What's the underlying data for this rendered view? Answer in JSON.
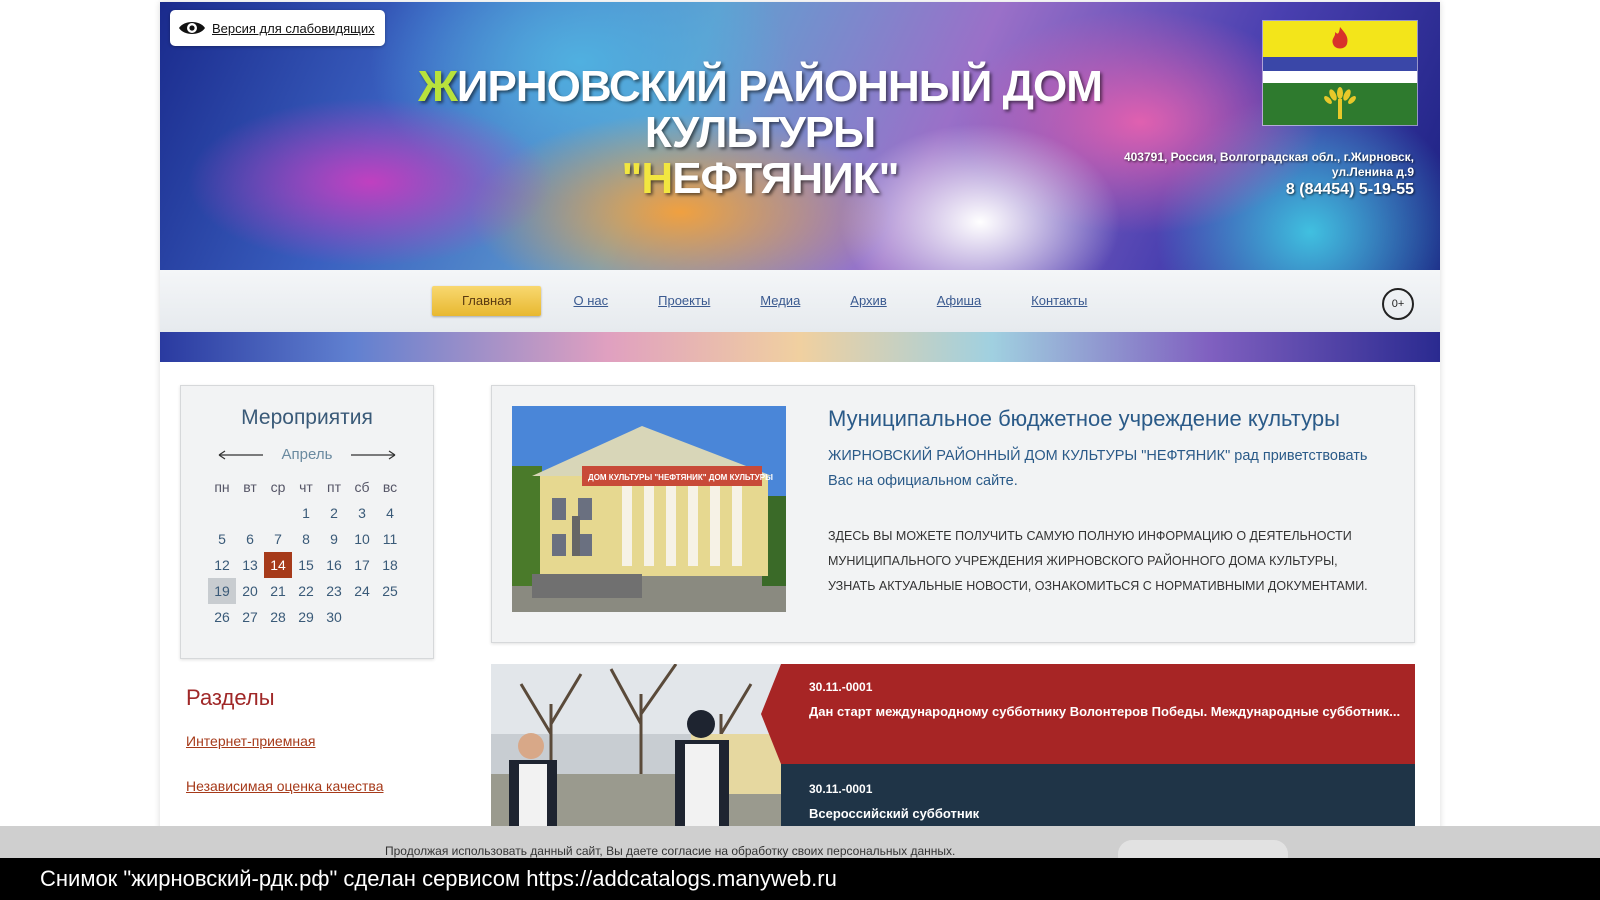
{
  "header": {
    "vision_label": "Версия для слабовидящих",
    "title_line1_first": "Ж",
    "title_line1_rest": "ИРНОВСКИЙ РАЙОННЫЙ ДОМ КУЛЬТУРЫ",
    "title_line2_open": "\"",
    "title_line2_first": "Н",
    "title_line2_rest": "ЕФТЯНИК\"",
    "address_line1": "403791, Россия, Волгоградская обл., г.Жирновск,",
    "address_line2": "ул.Ленина д.9",
    "phone": "8 (84454) 5-19-55"
  },
  "nav": {
    "items": [
      {
        "label": "Главная",
        "active": true
      },
      {
        "label": "О нас",
        "active": false
      },
      {
        "label": "Проекты",
        "active": false
      },
      {
        "label": "Медиа",
        "active": false
      },
      {
        "label": "Архив",
        "active": false
      },
      {
        "label": "Афиша",
        "active": false
      },
      {
        "label": "Контакты",
        "active": false
      }
    ],
    "age_rating": "0+"
  },
  "calendar": {
    "title": "Мероприятия",
    "month": "Апрель",
    "weekdays": [
      "пн",
      "вт",
      "ср",
      "чт",
      "пт",
      "сб",
      "вс"
    ],
    "weeks": [
      [
        "",
        "",
        "",
        "1",
        "2",
        "3",
        "4"
      ],
      [
        "5",
        "6",
        "7",
        "8",
        "9",
        "10",
        "11"
      ],
      [
        "12",
        "13",
        "14",
        "15",
        "16",
        "17",
        "18"
      ],
      [
        "19",
        "20",
        "21",
        "22",
        "23",
        "24",
        "25"
      ],
      [
        "26",
        "27",
        "28",
        "29",
        "30",
        "",
        ""
      ]
    ],
    "today": "14",
    "selected": "19"
  },
  "sections": {
    "title": "Разделы",
    "links": [
      "Интернет-приемная",
      "Независимая оценка качества"
    ]
  },
  "welcome": {
    "heading": "Муниципальное бюджетное учреждение культуры",
    "intro": "ЖИРНОВСКИЙ РАЙОННЫЙ ДОМ КУЛЬТУРЫ \"НЕФТЯНИК\" рад приветствовать Вас на официальном сайте.",
    "body": "ЗДЕСЬ ВЫ МОЖЕТЕ ПОЛУЧИТЬ САМУЮ ПОЛНУЮ ИНФОРМАЦИЮ О ДЕЯТЕЛЬНОСТИ МУНИЦИПАЛЬНОГО УЧРЕЖДЕНИЯ ЖИРНОВСКОГО РАЙОННОГО ДОМА КУЛЬТУРЫ, УЗНАТЬ АКТУАЛЬНЫЕ НОВОСТИ, ОЗНАКОМИТЬСЯ С НОРМАТИВНЫМИ ДОКУМЕНТАМИ.",
    "photo_sign": "ДОМ КУЛЬТУРЫ \"НЕФТЯНИК\" ДОМ КУЛЬТУРЫ"
  },
  "news": [
    {
      "date": "30.11.-0001",
      "title": "Дан старт международному субботнику Волонтеров  Победы. Международные субботник..."
    },
    {
      "date": "30.11.-0001",
      "title": "Всероссийский субботник"
    }
  ],
  "cookie": {
    "text": "Продолжая использовать данный сайт, Вы даете согласие на обработку своих персональных данных."
  },
  "footer": {
    "text": "Снимок \"жирновский-рдк.рф\" сделан сервисом https://addcatalogs.manyweb.ru"
  },
  "colors": {
    "accent_red": "#a72525",
    "news_dark": "#1f3447",
    "link_blue": "#3a5a90",
    "nav_active": "#e8b830",
    "today_bg": "#a63a1a"
  }
}
